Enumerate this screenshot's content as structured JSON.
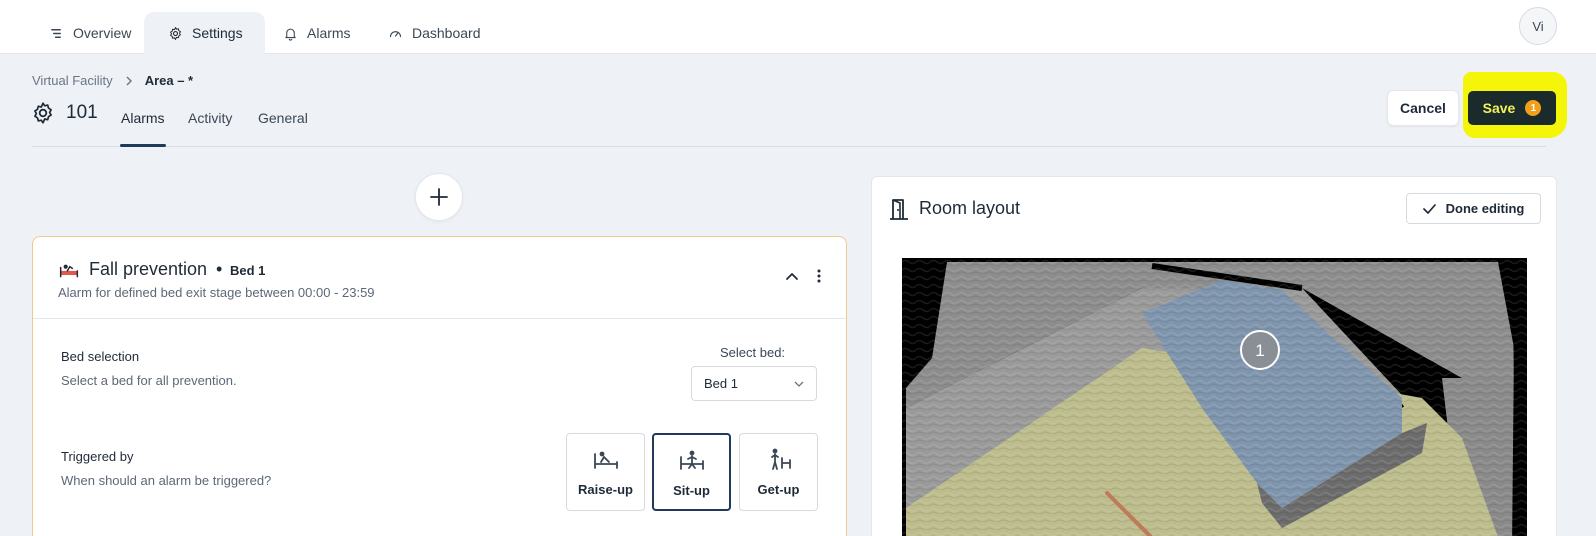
{
  "nav": {
    "tabs": [
      {
        "label": "Overview",
        "icon": "list-icon"
      },
      {
        "label": "Settings",
        "icon": "gear-icon",
        "active": true
      },
      {
        "label": "Alarms",
        "icon": "bell-icon"
      },
      {
        "label": "Dashboard",
        "icon": "gauge-icon"
      }
    ],
    "avatar": "Vi"
  },
  "breadcrumb": {
    "parent": "Virtual Facility",
    "separator": ">",
    "current": "Area – *"
  },
  "header": {
    "room": "101",
    "tabs": [
      "Alarms",
      "Activity",
      "General"
    ],
    "active_tab": "Alarms",
    "cancel_label": "Cancel",
    "save_label": "Save",
    "save_badge": "1"
  },
  "alarm": {
    "title": "Fall prevention",
    "bullet": "•",
    "bed": "Bed 1",
    "description": "Alarm for defined bed exit stage between 00:00 - 23:59",
    "bed_selection": {
      "label": "Bed selection",
      "help": "Select a bed for all prevention.",
      "select_label": "Select bed:",
      "selected_value": "Bed 1"
    },
    "triggered_by": {
      "label": "Triggered by",
      "help": "When should an alarm be triggered?",
      "options": [
        {
          "label": "Raise-up",
          "selected": false
        },
        {
          "label": "Sit-up",
          "selected": true
        },
        {
          "label": "Get-up",
          "selected": false
        }
      ]
    }
  },
  "room_layout": {
    "title": "Room layout",
    "done_label": "Done editing",
    "bed_marker": "1"
  },
  "colors": {
    "accent": "#1f3a5a",
    "card_border": "#f0c98f",
    "highlight": "#f5f50a",
    "badge": "#f2a01c",
    "bed_zone": "#7f95ad",
    "floor_zone": "#bcbc8c"
  }
}
